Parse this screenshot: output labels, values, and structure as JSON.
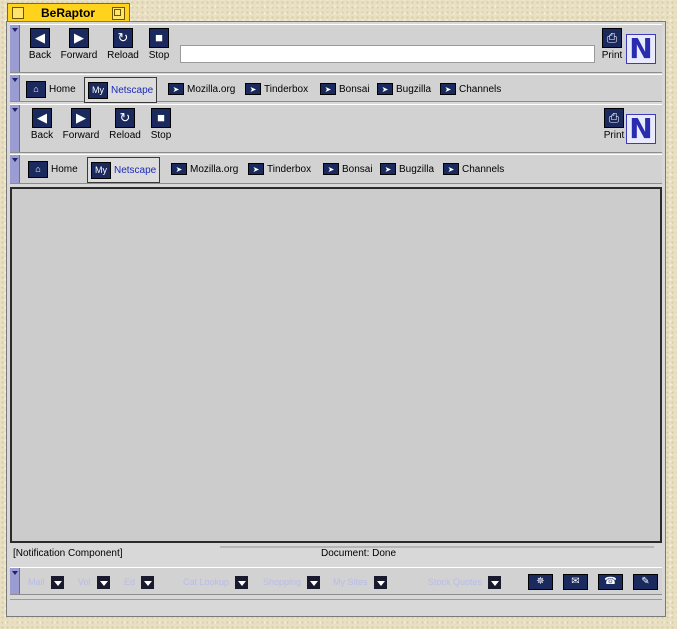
{
  "window": {
    "title": "BeRaptor"
  },
  "nav": {
    "back": "Back",
    "forward": "Forward",
    "reload": "Reload",
    "stop": "Stop",
    "print": "Print",
    "url": ""
  },
  "personal": {
    "items": [
      "Home",
      "Netscape",
      "Mozilla.org",
      "Tinderbox",
      "Bonsai",
      "Bugzilla",
      "Channels"
    ]
  },
  "status": {
    "notification": "[Notification Component]",
    "document": "Document: Done"
  },
  "bottom": {
    "menus": [
      "Mail",
      "Vol",
      "Ed",
      "Cat Lookup",
      "Shopping",
      "My Sites",
      "Stock Quotes"
    ]
  },
  "colors": {
    "accent": "#1c2ab8",
    "tab": "#ffd21c",
    "grip": "#9a9cd2"
  }
}
